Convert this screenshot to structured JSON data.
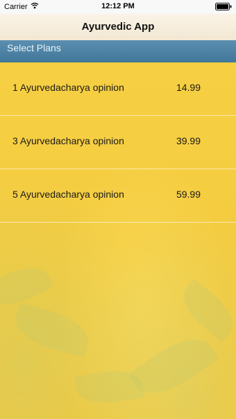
{
  "status_bar": {
    "carrier": "Carrier",
    "time": "12:12 PM"
  },
  "nav": {
    "title": "Ayurvedic App"
  },
  "section": {
    "title": "Select Plans"
  },
  "plans": [
    {
      "label": "1 Ayurvedacharya opinion",
      "price": "14.99"
    },
    {
      "label": "3 Ayurvedacharya opinion",
      "price": "39.99"
    },
    {
      "label": "5 Ayurvedacharya opinion",
      "price": "59.99"
    }
  ],
  "colors": {
    "header_blue": "#4a81a3",
    "background_yellow": "#f6cf43"
  },
  "icons": [
    "wifi-icon",
    "battery-icon"
  ]
}
